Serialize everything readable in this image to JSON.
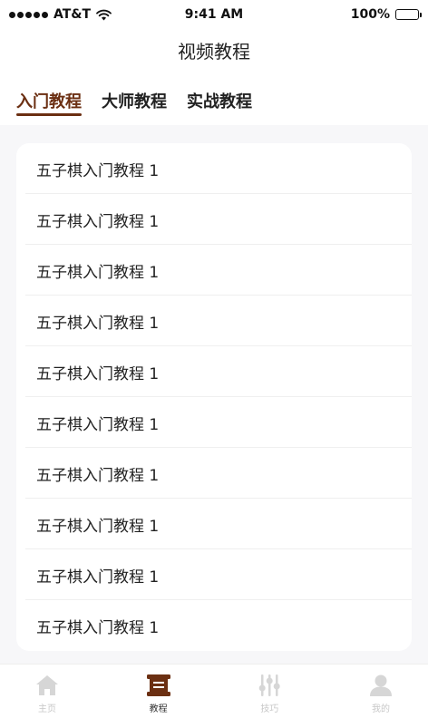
{
  "status": {
    "carrier": "AT&T",
    "time": "9:41 AM",
    "battery": "100%"
  },
  "header": {
    "title": "视频教程"
  },
  "tabs": [
    {
      "label": "入门教程",
      "active": true
    },
    {
      "label": "大师教程",
      "active": false
    },
    {
      "label": "实战教程",
      "active": false
    }
  ],
  "list": {
    "items": [
      "五子棋入门教程 1",
      "五子棋入门教程 1",
      "五子棋入门教程 1",
      "五子棋入门教程 1",
      "五子棋入门教程 1",
      "五子棋入门教程 1",
      "五子棋入门教程 1",
      "五子棋入门教程 1",
      "五子棋入门教程 1",
      "五子棋入门教程 1"
    ]
  },
  "tabbar": {
    "items": [
      {
        "label": "主页",
        "icon": "home-icon",
        "active": false
      },
      {
        "label": "教程",
        "icon": "scroll-icon",
        "active": true
      },
      {
        "label": "技巧",
        "icon": "sliders-icon",
        "active": false
      },
      {
        "label": "我的",
        "icon": "user-icon",
        "active": false
      }
    ]
  },
  "colors": {
    "accent": "#6b2f12",
    "inactive_icon": "#d6d6d6",
    "background": "#f7f7f9"
  }
}
